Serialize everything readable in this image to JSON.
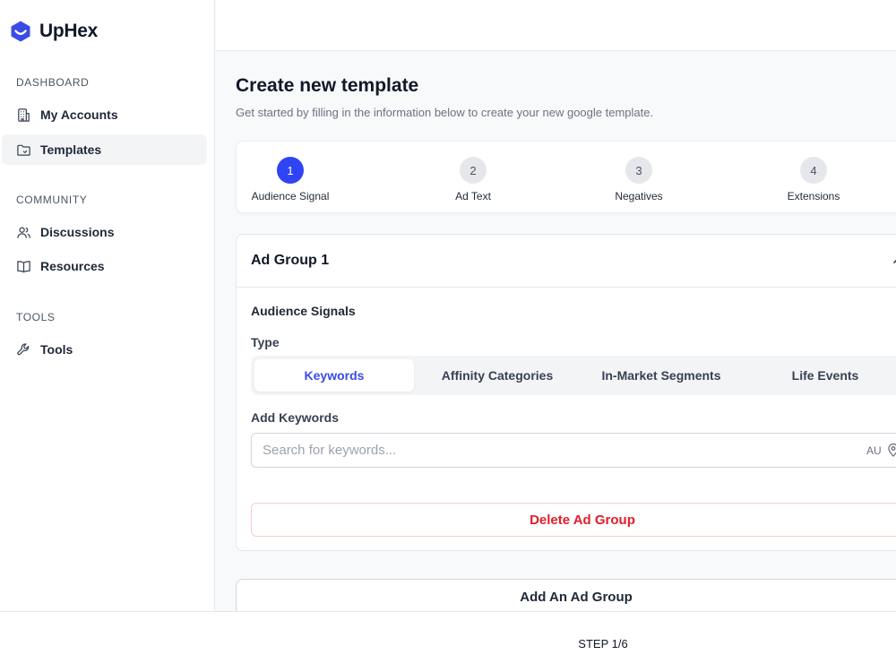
{
  "brand": {
    "name": "UpHex",
    "color": "#3b4be8"
  },
  "sidebar": {
    "sections": [
      {
        "title": "DASHBOARD",
        "items": [
          {
            "label": "My Accounts",
            "icon": "building-icon"
          },
          {
            "label": "Templates",
            "icon": "folder-icon",
            "active": true
          }
        ]
      },
      {
        "title": "COMMUNITY",
        "items": [
          {
            "label": "Discussions",
            "icon": "users-icon"
          },
          {
            "label": "Resources",
            "icon": "book-icon"
          }
        ]
      },
      {
        "title": "TOOLS",
        "items": [
          {
            "label": "Tools",
            "icon": "wrench-icon"
          }
        ]
      }
    ]
  },
  "header": {
    "title": "Create new template",
    "subtitle": "Get started by filling in the information below to create your new google template."
  },
  "steps": [
    {
      "number": "1",
      "label": "Audience Signal",
      "active": true
    },
    {
      "number": "2",
      "label": "Ad Text"
    },
    {
      "number": "3",
      "label": "Negatives"
    },
    {
      "number": "4",
      "label": "Extensions"
    }
  ],
  "ad_group": {
    "title": "Ad Group 1",
    "section_title": "Audience Signals",
    "type_label": "Type",
    "types": [
      {
        "label": "Keywords",
        "active": true
      },
      {
        "label": "Affinity Categories"
      },
      {
        "label": "In-Market Segments"
      },
      {
        "label": "Life Events"
      }
    ],
    "add_keywords_label": "Add Keywords",
    "search_placeholder": "Search for keywords...",
    "search_value": "",
    "location_code": "AU",
    "delete_label": "Delete Ad Group"
  },
  "add_group_label": "Add An Ad Group",
  "footer": {
    "step_text": "STEP 1/6"
  },
  "colors": {
    "accent": "#2f44f5",
    "danger": "#e11d2a"
  }
}
